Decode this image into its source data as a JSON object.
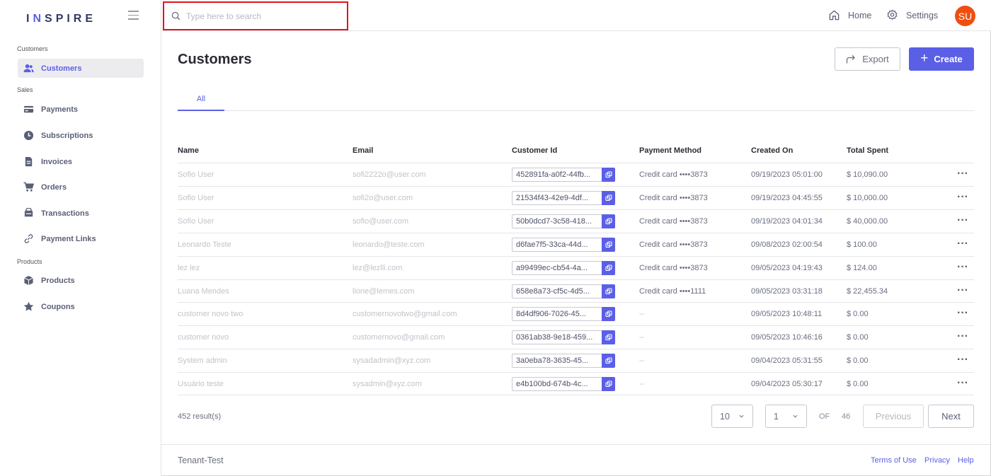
{
  "brand": {
    "logo_pre": "I",
    "logo_accent": "N",
    "logo_post": "SPIRE",
    "accent_color": "#5b5fe6",
    "avatar_color": "#f04e10"
  },
  "sidebar": {
    "sections": [
      {
        "label": "Customers"
      },
      {
        "label": "Sales"
      },
      {
        "label": "Products"
      }
    ],
    "items": [
      {
        "label": "Customers",
        "icon": "users-icon",
        "active": true
      },
      {
        "label": "Payments",
        "icon": "credit-card-icon"
      },
      {
        "label": "Subscriptions",
        "icon": "clock-icon"
      },
      {
        "label": "Invoices",
        "icon": "document-icon"
      },
      {
        "label": "Orders",
        "icon": "cart-icon"
      },
      {
        "label": "Transactions",
        "icon": "wallet-icon"
      },
      {
        "label": "Payment Links",
        "icon": "link-icon"
      },
      {
        "label": "Products",
        "icon": "box-icon"
      },
      {
        "label": "Coupons",
        "icon": "star-icon"
      }
    ]
  },
  "topbar": {
    "search_placeholder": "Type here to search",
    "home_label": "Home",
    "settings_label": "Settings",
    "avatar_initials": "SU"
  },
  "main": {
    "title": "Customers",
    "export_label": "Export",
    "create_label": "Create",
    "tab_all": "All"
  },
  "table": {
    "headers": {
      "name": "Name",
      "email": "Email",
      "customer_id": "Customer Id",
      "payment_method": "Payment Method",
      "created_on": "Created On",
      "total_spent": "Total Spent"
    },
    "rows": [
      {
        "name": "Sofio User",
        "email": "sofi2222o@user.com",
        "id": "452891fa-a0f2-44fb...",
        "payment": "Credit card ••••3873",
        "created": "09/19/2023 05:01:00",
        "total": "$ 10,090.00"
      },
      {
        "name": "Sofio User",
        "email": "sofi2o@user.com",
        "id": "21534f43-42e9-4df...",
        "payment": "Credit card ••••3873",
        "created": "09/19/2023 04:45:55",
        "total": "$ 10,000.00"
      },
      {
        "name": "Sofio User",
        "email": "sofio@user.com",
        "id": "50b0dcd7-3c58-418...",
        "payment": "Credit card ••••3873",
        "created": "09/19/2023 04:01:34",
        "total": "$ 40,000.00"
      },
      {
        "name": "Leonardo Teste",
        "email": "leonardo@teste.com",
        "id": "d6fae7f5-33ca-44d...",
        "payment": "Credit card ••••3873",
        "created": "09/08/2023 02:00:54",
        "total": "$ 100.00"
      },
      {
        "name": "lez lez",
        "email": "lez@lezlli.com",
        "id": "a99499ec-cb54-4a...",
        "payment": "Credit card ••••3873",
        "created": "09/05/2023 04:19:43",
        "total": "$ 124.00"
      },
      {
        "name": "Luana Mendes",
        "email": "lione@lemes.com",
        "id": "658e8a73-cf5c-4d5...",
        "payment": "Credit card ••••1111",
        "created": "09/05/2023 03:31:18",
        "total": "$ 22,455.34"
      },
      {
        "name": "customer novo two",
        "email": "customernovotwo@gmail.com",
        "id": "8d4df906-7026-45...",
        "payment": "--",
        "created": "09/05/2023 10:48:11",
        "total": "$ 0.00"
      },
      {
        "name": "customer novo",
        "email": "customernovo@gmail.com",
        "id": "0361ab38-9e18-459...",
        "payment": "--",
        "created": "09/05/2023 10:46:16",
        "total": "$ 0.00"
      },
      {
        "name": "System admin",
        "email": "sysadadmin@xyz.com",
        "id": "3a0eba78-3635-45...",
        "payment": "--",
        "created": "09/04/2023 05:31:55",
        "total": "$ 0.00"
      },
      {
        "name": "Usuário teste",
        "email": "sysadmin@xyz.com",
        "id": "e4b100bd-674b-4c...",
        "payment": "--",
        "created": "09/04/2023 05:30:17",
        "total": "$ 0.00"
      }
    ]
  },
  "pagination": {
    "results": "452 result(s)",
    "page_size": "10",
    "page": "1",
    "of_label": "OF",
    "total_pages": "46",
    "previous_label": "Previous",
    "next_label": "Next"
  },
  "footer": {
    "tenant": "Tenant-Test",
    "terms": "Terms of Use",
    "privacy": "Privacy",
    "help": "Help"
  }
}
